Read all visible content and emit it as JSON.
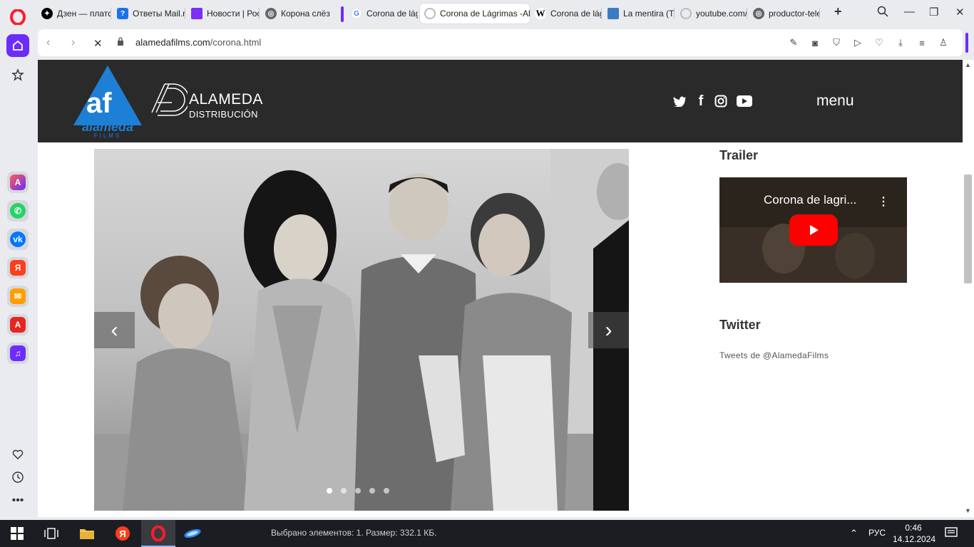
{
  "tabs": [
    {
      "title": "Дзен — платф",
      "icon": "dzen-icon",
      "color": "#000000"
    },
    {
      "title": "Ответы Mail.r",
      "icon": "question-icon",
      "color": "#1a73e8"
    },
    {
      "title": "Новости | Рос",
      "icon": "pen-icon",
      "color": "#7b2ff7"
    },
    {
      "title": "Корона слёз",
      "icon": "globe-icon",
      "color": "#555555"
    },
    {
      "title": "Corona de lág",
      "icon": "google-icon",
      "color": "#4285f4"
    },
    {
      "title": "Corona de Lágrimas -Al",
      "icon": "loading-icon",
      "color": "#aaaaaa"
    },
    {
      "title": "Corona de lág",
      "icon": "wikipedia-icon",
      "color": "#000000"
    },
    {
      "title": "La mentira (TV",
      "icon": "photo-icon",
      "color": "#3b7bbf"
    },
    {
      "title": "youtube.com/",
      "icon": "loading-icon",
      "color": "#aaaaaa"
    },
    {
      "title": "productor-tele",
      "icon": "globe-icon",
      "color": "#555555"
    }
  ],
  "address": {
    "domain": "alamedafilms.com",
    "path": "/corona.html"
  },
  "site": {
    "logo_text": "alameda",
    "logo_sub": "FILMS",
    "dist_name": "ALAMEDA",
    "dist_sub": "DISTRIBUCIÓN",
    "menu_label": "menu",
    "social": [
      "twitter-icon",
      "facebook-icon",
      "instagram-icon",
      "youtube-icon"
    ]
  },
  "slider": {
    "dots": 5,
    "active_dot": 0
  },
  "trailer": {
    "heading": "Trailer",
    "video_title": "Corona de lagri..."
  },
  "twitter": {
    "heading": "Twitter",
    "feed_label": "Tweets de @AlamedaFilms"
  },
  "taskbar": {
    "status": "Выбрано элементов: 1. Размер: 332.1 КБ.",
    "lang": "РУС",
    "time": "0:46",
    "date": "14.12.2024"
  }
}
